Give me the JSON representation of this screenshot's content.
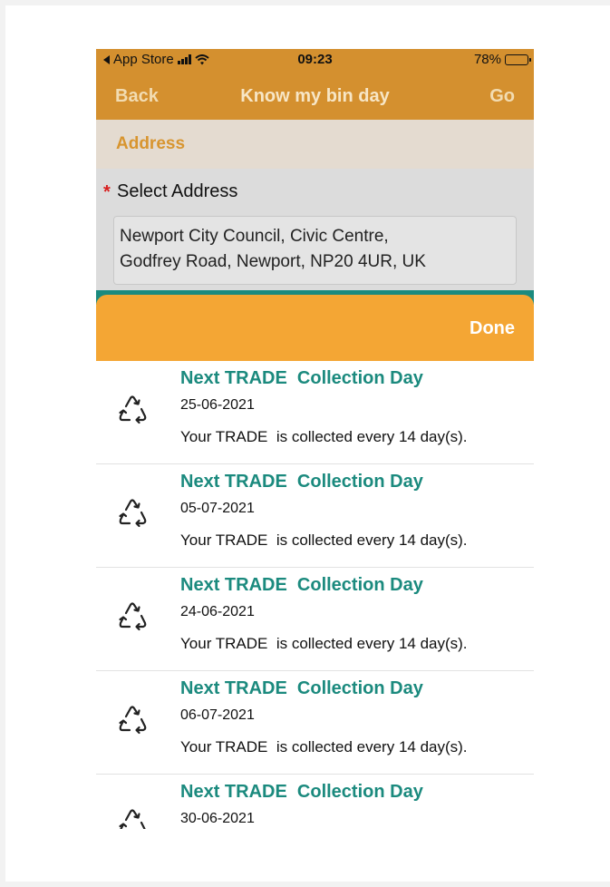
{
  "status_bar": {
    "carrier": "App Store",
    "time": "09:23",
    "battery": "78%",
    "battery_level": 0.78
  },
  "nav": {
    "back_label": "Back",
    "title": "Know my bin day",
    "go_label": "Go"
  },
  "address_section": {
    "header": "Address",
    "required_marker": "*",
    "field_label": "Select Address",
    "address_line1": "Newport City Council, Civic Centre,",
    "address_line2": "Godfrey Road, Newport, NP20 4UR, UK"
  },
  "sheet": {
    "done_label": "Done"
  },
  "collections": [
    {
      "title": "Next TRADE  Collection Day",
      "date": "25-06-2021",
      "desc": "Your TRADE  is collected every 14 day(s).",
      "icon": "recycle-icon"
    },
    {
      "title": "Next TRADE  Collection Day",
      "date": "05-07-2021",
      "desc": "Your TRADE  is collected every 14 day(s).",
      "icon": "recycle-icon"
    },
    {
      "title": "Next TRADE  Collection Day",
      "date": "24-06-2021",
      "desc": "Your TRADE  is collected every 14 day(s).",
      "icon": "recycle-icon"
    },
    {
      "title": "Next TRADE  Collection Day",
      "date": "06-07-2021",
      "desc": "Your TRADE  is collected every 14 day(s).",
      "icon": "recycle-icon"
    },
    {
      "title": "Next TRADE  Collection Day",
      "date": "30-06-2021",
      "desc": "",
      "icon": "recycle-icon"
    }
  ],
  "colors": {
    "header_orange": "#d4902f",
    "sheet_orange": "#f4a634",
    "teal": "#1b8a7e",
    "required_red": "#d82020"
  }
}
